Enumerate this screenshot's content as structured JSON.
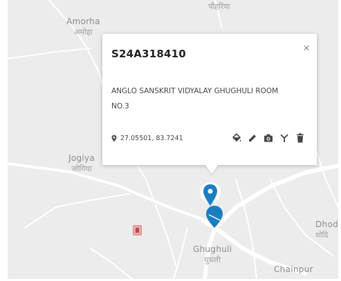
{
  "map": {
    "places": [
      {
        "id": "amorha",
        "name_en": "Amorha",
        "name_hi": "अमोहा"
      },
      {
        "id": "jogiya",
        "name_en": "Jogiya",
        "name_hi": "जोगिया"
      },
      {
        "id": "ghughuli",
        "name_en": "Ghughuli",
        "name_hi": "घुघली"
      },
      {
        "id": "dhodi",
        "name_en": "Dhod",
        "name_hi": "धोदि"
      },
      {
        "id": "chainpur",
        "name_en": "Chainpur",
        "name_hi": ""
      },
      {
        "id": "top",
        "name_en": "",
        "name_hi": "पौहरिया"
      }
    ],
    "colors": {
      "background": "#ececec",
      "road": "#ffffff",
      "marker": "#1a7fc1",
      "popup_bg": "#ffffff"
    }
  },
  "popup": {
    "title": "S24A318410",
    "close_icon": "×",
    "address": "ANGLO SANSKRIT VIDYALAY GHUGHULI ROOM NO.3",
    "coordinates": "27.05501, 83.7241",
    "actions": [
      {
        "name": "fill-icon",
        "label": "fill"
      },
      {
        "name": "edit-icon",
        "label": "edit"
      },
      {
        "name": "camera-icon",
        "label": "camera"
      },
      {
        "name": "antenna-icon",
        "label": "antenna"
      },
      {
        "name": "delete-icon",
        "label": "delete"
      }
    ]
  }
}
